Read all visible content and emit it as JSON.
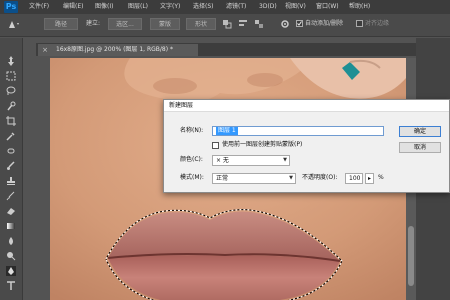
{
  "app": {
    "logo": "Ps"
  },
  "menubar": {
    "items": [
      "文件(F)",
      "编辑(E)",
      "图像(I)",
      "图层(L)",
      "文字(Y)",
      "选择(S)",
      "滤镜(T)",
      "3D(D)",
      "视图(V)",
      "窗口(W)",
      "帮助(H)"
    ]
  },
  "options_bar": {
    "btn_1": "路径",
    "label_build": "建立:",
    "btn_selection": "选区...",
    "btn_mask": "蒙版",
    "btn_shape": "形状",
    "auto_add_delete": "自动添加/删除",
    "align_edges": "对齐边缘"
  },
  "document": {
    "tab_title": "16x8原图.jpg @ 200% (图层 1, RGB/8) *"
  },
  "dialog": {
    "title": "新建图层",
    "name_label": "名称(N):",
    "name_value": "图层 1",
    "clip_mask_label": "使用前一图层创建剪贴蒙版(P)",
    "color_label": "颜色(C):",
    "color_value": "× 无",
    "mode_label": "模式(M):",
    "mode_value": "正常",
    "opacity_label": "不透明度(O):",
    "opacity_value": "100",
    "opacity_unit": "%",
    "ok": "确定",
    "cancel": "取消"
  }
}
